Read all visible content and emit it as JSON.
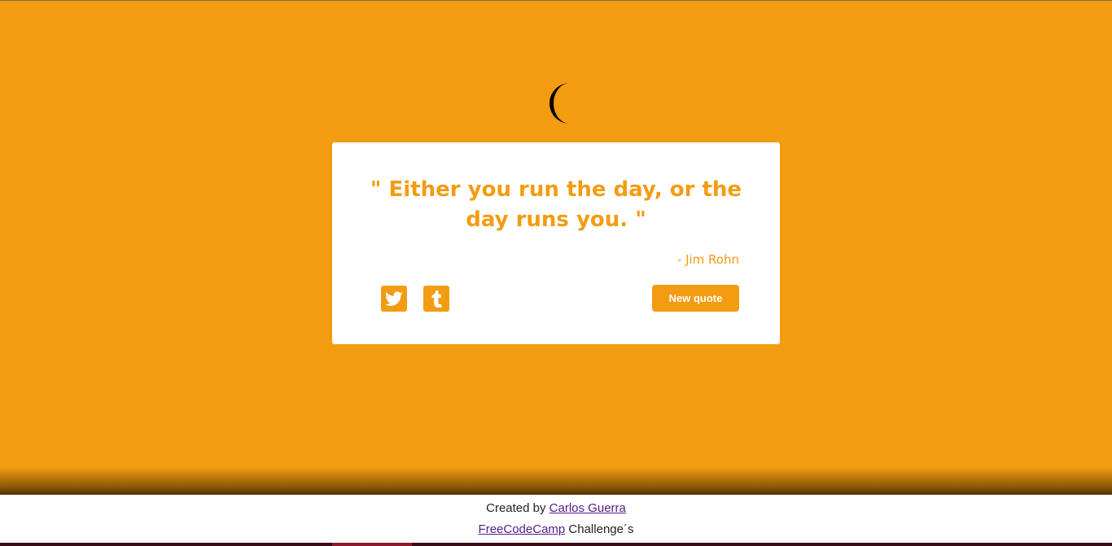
{
  "quote": {
    "text": "\" Either you run the day, or the day runs you. \"",
    "author": "- Jim Rohn"
  },
  "actions": {
    "new_quote_label": "New quote",
    "twitter_icon": "twitter-icon",
    "tumblr_icon": "tumblr-icon"
  },
  "header": {
    "moon_icon": "moon-icon"
  },
  "footer": {
    "created_by": "Created by ",
    "author_link": "Carlos Guerra",
    "fcc_link": "FreeCodeCamp",
    "challenges": " Challenge´s"
  },
  "colors": {
    "accent": "#f39c12",
    "card": "#ffffff",
    "link": "#551a8b"
  }
}
